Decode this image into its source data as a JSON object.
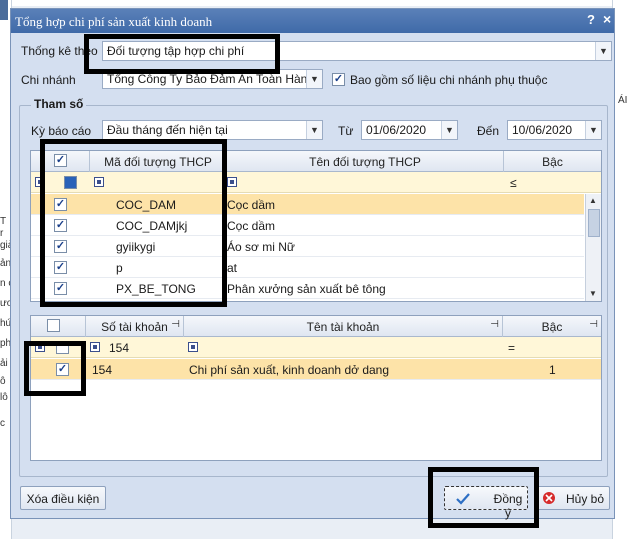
{
  "background": {
    "left_lines": [
      "T",
      "r",
      "giải",
      "ản",
      "n c",
      "ươ",
      "hứ",
      "ph",
      "ải",
      "ỗ",
      "lỗ",
      "c"
    ],
    "right_text": "ÁI"
  },
  "dialog": {
    "title": "Tổng hợp chi phí sản xuất kinh doanh",
    "help": "?",
    "close": "×"
  },
  "form": {
    "thong_ke_theo_label": "Thống kê theo",
    "thong_ke_theo_value": "Đối tượng tập hợp chi phí",
    "chi_nhanh_label": "Chi nhánh",
    "chi_nhanh_value": "Tổng Công Ty Bảo Đảm An Toàn Hàng H",
    "include_branch_label": "Bao gồm số liệu chi nhánh phụ thuộc",
    "include_branch_checked": true,
    "tham_so_label": "Tham số",
    "ky_bao_cao_label": "Kỳ báo cáo",
    "ky_bao_cao_value": "Đầu tháng đến hiện tại",
    "tu_label": "Từ",
    "tu_value": "01/06/2020",
    "den_label": "Đến",
    "den_value": "10/06/2020"
  },
  "grid1": {
    "headers": [
      "Mã đối tượng THCP",
      "Tên đối tượng THCP",
      "Bậc"
    ],
    "filter_bac": "≤",
    "rows": [
      {
        "code": "COC_DAM",
        "name": "Cọc dầm",
        "checked": true
      },
      {
        "code": "COC_DAMjkj",
        "name": "Cọc dầm",
        "checked": true
      },
      {
        "code": "gyiikygi",
        "name": "Áo sơ mi Nữ",
        "checked": true
      },
      {
        "code": "p",
        "name": "at",
        "checked": true
      },
      {
        "code": "PX_BE_TONG",
        "name": "Phân xưởng sản xuất bê tông",
        "checked": true
      }
    ]
  },
  "grid2": {
    "headers": [
      "Số tài khoản",
      "Tên tài khoản",
      "Bậc"
    ],
    "filter_account": "154",
    "filter_bac": "=",
    "rows": [
      {
        "account": "154",
        "name": "Chi phí sản xuất, kinh doanh dở dang",
        "level": "1",
        "checked": true
      }
    ]
  },
  "buttons": {
    "clear": "Xóa điều kiện",
    "ok": "Đồng ý",
    "cancel": "Hủy bỏ"
  },
  "colors": {
    "title_bar": "#4a74b0",
    "selected_row": "#fde3a8",
    "filter_row": "#fff7d8",
    "cancel_icon": "#d62b2b"
  }
}
